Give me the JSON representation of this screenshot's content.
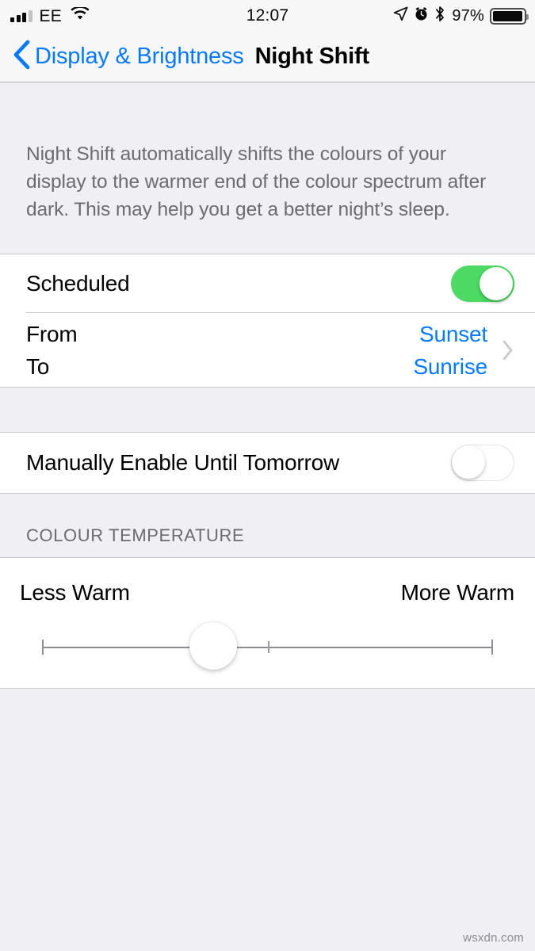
{
  "status_bar": {
    "carrier": "EE",
    "signal_bars_filled": 3,
    "signal_bars_total": 4,
    "wifi": "wifi-icon",
    "time": "12:07",
    "location_icon": "location-arrow-icon",
    "alarm_icon": "alarm-clock-icon",
    "bluetooth_icon": "bluetooth-icon",
    "battery_percent": "97%",
    "battery_level": 97
  },
  "nav_bar": {
    "back_label": "Display & Brightness",
    "back_icon": "chevron-left-icon",
    "title": "Night Shift",
    "accent_color": "#067AFE"
  },
  "main": {
    "description": "Night Shift automatically shifts the colours of your display to the warmer end of the colour spectrum after dark. This may help you get a better night’s sleep.",
    "schedule_section": {
      "scheduled_row": {
        "label": "Scheduled",
        "toggle_state": "on",
        "toggle_on_color": "#4CD964"
      },
      "time_row": {
        "from_label": "From",
        "to_label": "To",
        "from_value": "Sunset",
        "to_value": "Sunrise",
        "disclosure_icon": "chevron-right-icon"
      }
    },
    "manual_section": {
      "label": "Manually Enable Until Tomorrow",
      "toggle_state": "off"
    },
    "temperature_section": {
      "header": "COLOUR TEMPERATURE",
      "less_warm_label": "Less Warm",
      "more_warm_label": "More Warm",
      "slider_value_percent": 38,
      "slider_midpoint_percent": 50
    }
  },
  "watermark": "wsxdn.com"
}
